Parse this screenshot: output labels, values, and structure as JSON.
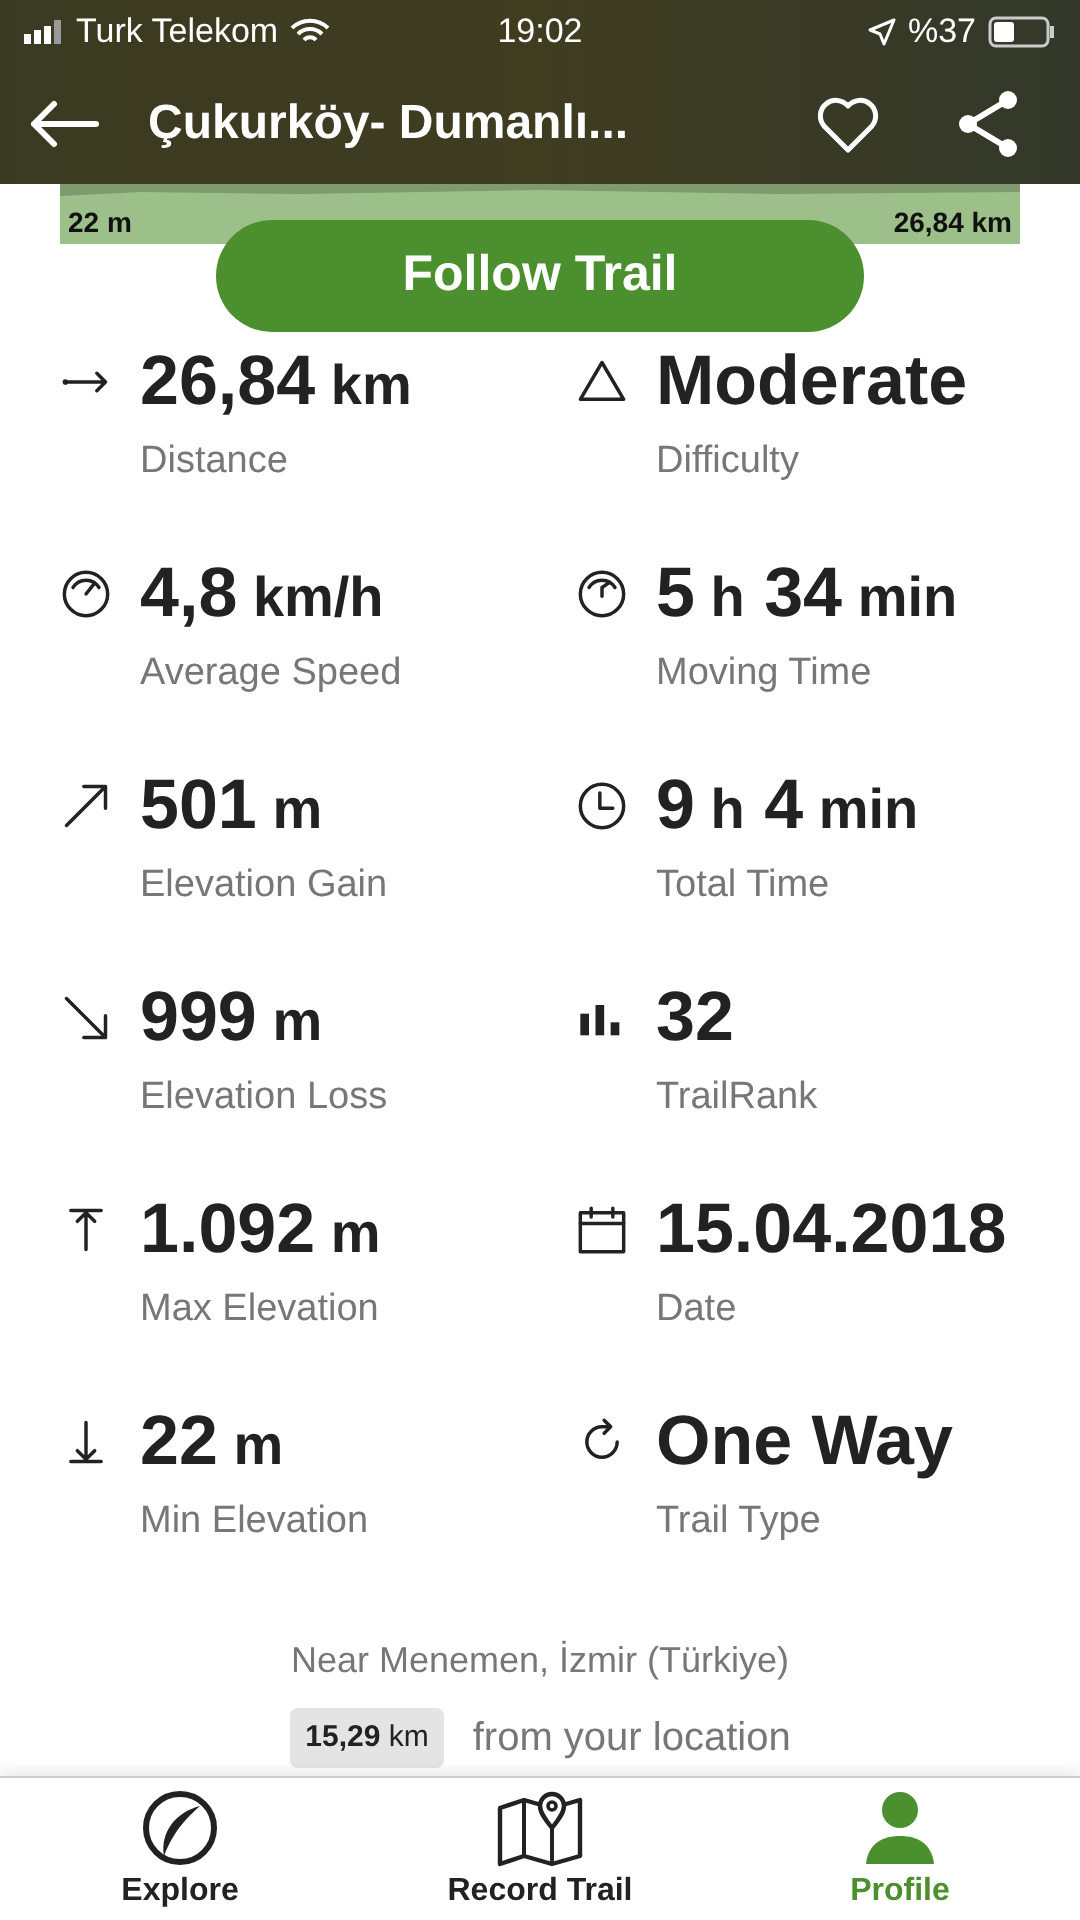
{
  "status_bar": {
    "carrier": "Turk Telekom",
    "time": "19:02",
    "battery": "%37"
  },
  "header": {
    "title": "Çukurköy- Dumanlı..."
  },
  "elevation_strip": {
    "start": "22 m",
    "end": "26,84 km"
  },
  "follow_button": "Follow Trail",
  "stats": [
    {
      "parts": [
        "26,84",
        "km"
      ],
      "label": "Distance"
    },
    {
      "parts": [
        "Moderate"
      ],
      "label": "Difficulty"
    },
    {
      "parts": [
        "4,8",
        "km/h"
      ],
      "label": "Average Speed"
    },
    {
      "parts": [
        "5",
        "h",
        "34",
        "min"
      ],
      "label": "Moving Time"
    },
    {
      "parts": [
        "501",
        "m"
      ],
      "label": "Elevation Gain"
    },
    {
      "parts": [
        "9",
        "h",
        "4",
        "min"
      ],
      "label": "Total Time"
    },
    {
      "parts": [
        "999",
        "m"
      ],
      "label": "Elevation Loss"
    },
    {
      "parts": [
        "32"
      ],
      "label": "TrailRank"
    },
    {
      "parts": [
        "1.092",
        "m"
      ],
      "label": "Max Elevation"
    },
    {
      "parts": [
        "15.04.2018"
      ],
      "label": "Date"
    },
    {
      "parts": [
        "22",
        "m"
      ],
      "label": "Min Elevation"
    },
    {
      "parts": [
        "One Way"
      ],
      "label": "Trail Type"
    }
  ],
  "location": "Near Menemen, İzmir (Türkiye)",
  "distance_from": {
    "number": "15,29",
    "unit": "km",
    "text": "from your location"
  },
  "tabs": [
    {
      "label": "Explore",
      "selected": false
    },
    {
      "label": "Record Trail",
      "selected": false
    },
    {
      "label": "Profile",
      "selected": true
    }
  ]
}
